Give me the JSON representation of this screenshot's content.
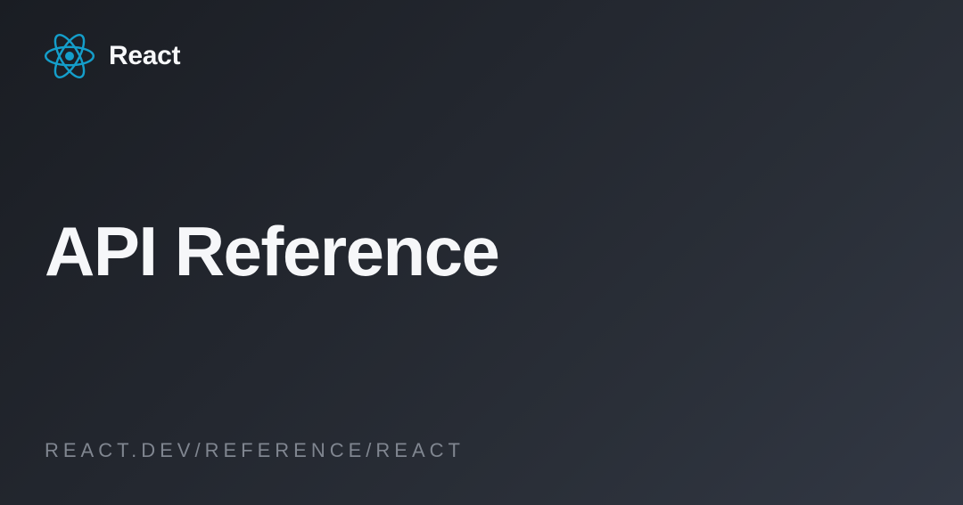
{
  "header": {
    "brand_name": "React"
  },
  "main": {
    "page_title": "API Reference"
  },
  "footer": {
    "url_path": "REACT.DEV/REFERENCE/REACT"
  },
  "colors": {
    "react_blue": "#149ECA",
    "text_primary": "#f6f7f9",
    "text_secondary": "#808690"
  }
}
